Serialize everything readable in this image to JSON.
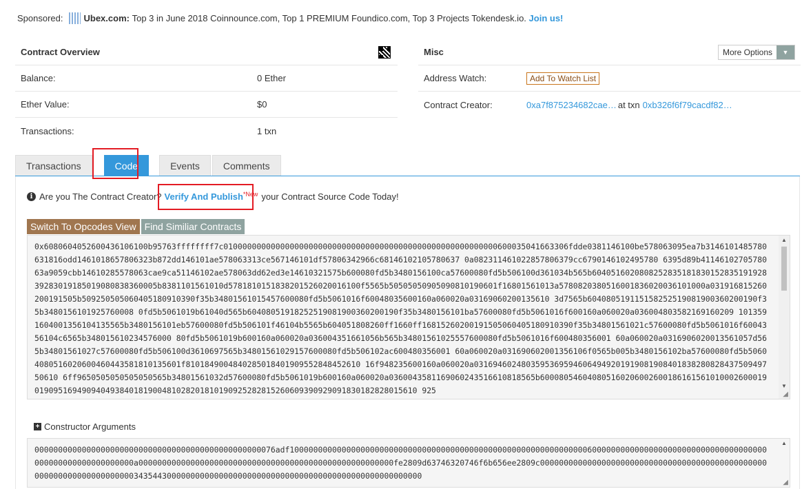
{
  "sponsor": {
    "label": "Sponsored:",
    "brand": "Ubex.com:",
    "text": "Top 3 in June 2018 Coinnounce.com, Top 1 PREMIUM Foundico.com, Top 3 Projects Tokendesk.io.",
    "cta": "Join us!"
  },
  "overview": {
    "title": "Contract Overview",
    "rows": [
      {
        "label": "Balance:",
        "value": "0 Ether"
      },
      {
        "label": "Ether Value:",
        "value": "$0"
      },
      {
        "label": "Transactions:",
        "value": "1 txn"
      }
    ]
  },
  "misc": {
    "title": "Misc",
    "more_options": "More Options",
    "address_watch_label": "Address Watch:",
    "watch_button": "Add To Watch List",
    "creator_label": "Contract Creator:",
    "creator_address": "0xa7f875234682cae…",
    "at_txn": "at txn",
    "creator_txn": "0xb326f6f79cacdf82…"
  },
  "tabs": [
    "Transactions",
    "Code",
    "Events",
    "Comments"
  ],
  "active_tab": "Code",
  "code": {
    "question": "Are you The Contract Creator?",
    "verify_link": "Verify And Publish",
    "new_badge": "*New",
    "question_suffix": "your Contract Source Code Today!",
    "switch_button": "Switch To Opcodes View",
    "find_button": "Find Similiar Contracts",
    "bytecode": "0x6080604052600436106100b95763ffffffff7c0100000000000000000000000000000000000000000000000000000000600035041663306fdde0381146100be578063095ea7b3146101485780631816odd1461018657806323b872dd146101ae578063313ce567146101df57806342966c68146102105780637 0a082311461022857806379cc6790146102495780 6395d89b4114610270578063a9059cbb14610285578063cae9ca51146102ae578063dd62ed3e14610321575b600080fd5b3480156100ca57600080fd5b506100d361034b565b604051602080825283518183015283519192839283019185019080838360005b8381101561010d5781810151838201526020016100f5565b50505050905090810190601f16801561013a5780820380516001836020036101000a031916815260200191505b509250505060405180910390f35b34801561015457600080fd5b5061016f60048035600160a060020a03169060200135610 3d7565b604080519115158252519081900360200190f35b3480156101925760008 0fd5b5061019b61040d565b60408051918252519081900360200190f35b3480156101ba57600080fd5b5061016f600160a060020a036004803582169160209 1013591604001356104135565b3480156101eb57600080fd5b506101f46104b5565b604051808260ff1660ff16815260200191505060405180910390f35b34801561021c57600080fd5b5061016f6004356104c6565b348015610234576000 80fd5b5061019b600160a060020a036004351661056b565b34801561025557600080fd5b5061016f600480356001 60a060020a0316906020013561057d565b34801561027c57600080fd5b506100d3610697565b34801561029157600080fd5b506102ac600480356001 60a060020a031690602001356106f0565b005b3480156102ba57600080fd5b50604080516020600460443581810135601f8101849004840285018401909552848452610 16f948235600160a060020a0316946024803595369594606494920191908190840183828082843750949750610 6ff9650505050505050565b34801561032d57600080fd5b5061019b600160a060020a0360043581169060243516610818565b600080546040805160206002600186161561010002600019019095169490940493840181900481028201810190925282815260609390929091830182828015610 925"
  },
  "constructor": {
    "title": "Constructor Arguments",
    "args": "000000000000000000000000000000000000000000000000076adf10000000000000000000000000000000000000000000000000000000000000060000000000000000000000000000000000000000000000000000000000a000000000000000000000000000000000000000000000000000000fe2809d63746320746f6b656ee2809c0000000000000000000000000000000000000000000000000000000000000000000003435443000000000000000000000000000000000000000000000000000000"
  }
}
